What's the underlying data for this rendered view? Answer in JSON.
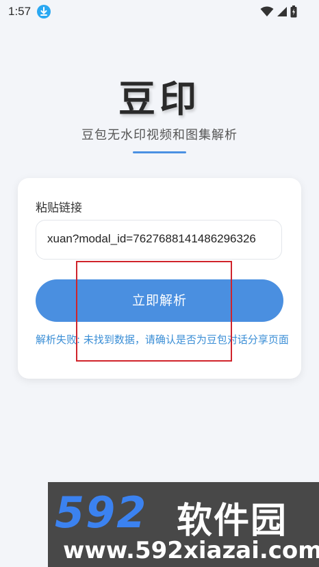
{
  "status_bar": {
    "time": "1:57",
    "icons": [
      "download-icon",
      "wifi-icon",
      "signal-icon",
      "battery-icon"
    ]
  },
  "header": {
    "title": "豆印",
    "subtitle": "豆包无水印视频和图集解析"
  },
  "card": {
    "label": "粘贴链接",
    "input_value": "xuan?modal_id=7627688141486296326",
    "button_label": "立即解析",
    "error_message": "解析失败: 未找到数据，请确认是否为豆包对话分享页面"
  },
  "watermark": {
    "logo_number": "592",
    "logo_text": "软件园",
    "url": "www.592xiazai.com"
  },
  "colors": {
    "accent": "#4a8fe0",
    "error_text": "#3a8ed6",
    "background": "#f3f5f9",
    "highlight": "#d0232a"
  }
}
